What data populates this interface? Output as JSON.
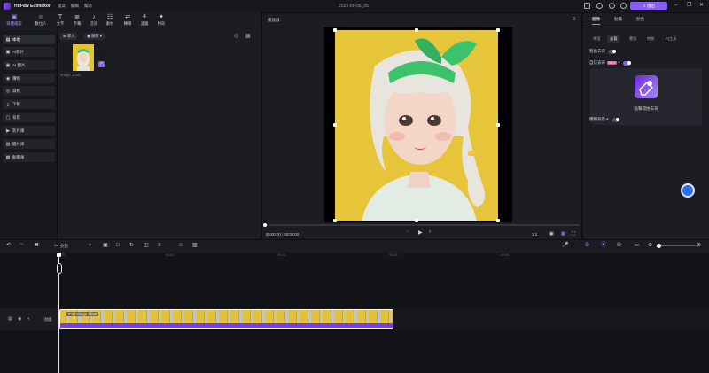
{
  "app": {
    "name": "HitPaw Edimakor",
    "menus": [
      "檔案",
      "編輯",
      "幫助"
    ],
    "doc_title": "2025-08-06_05",
    "export_label": "匯出"
  },
  "toolbar": {
    "items": [
      {
        "label": "媒體檔案",
        "icon": "folder-icon"
      },
      {
        "label": "數位人",
        "icon": "avatar-icon"
      },
      {
        "label": "文字",
        "icon": "text-icon"
      },
      {
        "label": "字幕",
        "icon": "subtitle-icon"
      },
      {
        "label": "音訊",
        "icon": "music-icon"
      },
      {
        "label": "素材",
        "icon": "asset-icon"
      },
      {
        "label": "轉場",
        "icon": "transition-icon"
      },
      {
        "label": "濾鏡",
        "icon": "filter-icon"
      },
      {
        "label": "特效",
        "icon": "effect-icon"
      }
    ],
    "active": 0
  },
  "sidebar": {
    "items": [
      {
        "label": "本地",
        "icon": "folder-icon"
      },
      {
        "label": "AI影片",
        "icon": "ai-video-icon"
      },
      {
        "label": "AI 圖片",
        "icon": "ai-image-icon"
      },
      {
        "label": "購物",
        "icon": "cart-icon"
      },
      {
        "label": "錄製",
        "icon": "record-icon"
      },
      {
        "label": "下載",
        "icon": "download-icon"
      },
      {
        "label": "背景",
        "icon": "background-icon"
      },
      {
        "label": "影片庫",
        "icon": "video-library-icon"
      },
      {
        "label": "圖片庫",
        "icon": "image-library-icon"
      },
      {
        "label": "動畫庫",
        "icon": "animation-library-icon"
      }
    ],
    "active": 0
  },
  "media": {
    "import_label": "導入",
    "record_label": "錄製",
    "file_name": "image 1050"
  },
  "preview": {
    "header": "播放器",
    "timecode": "00:00:00 / 00:03:00",
    "zoom": "1:1"
  },
  "props": {
    "tabs": [
      "圖像",
      "動畫",
      "顏色"
    ],
    "active_tab": 0,
    "subtabs": [
      "常用",
      "去背",
      "蒙版",
      "特效",
      "AI工具"
    ],
    "active_subtab": 1,
    "smart_bg_label": "智能去背",
    "custom_bg_label": "自訂去背",
    "custom_badge": "NEW",
    "start_bg_label": "點擊開始去背",
    "blur_bg_label": "模糊背景"
  },
  "timeline": {
    "split_label": "分割",
    "ticks": [
      "00:00",
      "00:01",
      "00:02",
      "00:03",
      "00:04"
    ],
    "track_label": "封面",
    "clip_label": "0:03 image 1050"
  },
  "colors": {
    "accent": "#8b5cf6",
    "clip_bar": "#7c3aed"
  }
}
